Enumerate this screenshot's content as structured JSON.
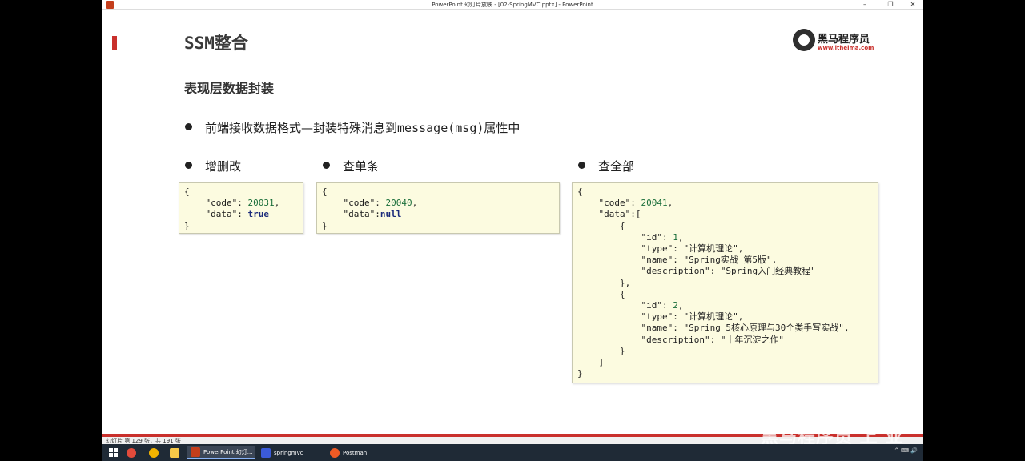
{
  "window": {
    "title": "PowerPoint 幻灯片放映 - [02-SpringMVC.pptx] - PowerPoint",
    "controls": [
      "–",
      "❐",
      "✕"
    ]
  },
  "slide": {
    "title": "SSM整合",
    "subtitle": "表现层数据封装",
    "logo": {
      "name": "黑马程序员",
      "url": "www.itheima.com"
    },
    "intro_bullet": "前端接收数据格式—封装特殊消息到",
    "intro_code": "message(msg)",
    "intro_tail": "属性中",
    "sections": [
      {
        "label": "增删改"
      },
      {
        "label": "查单条"
      },
      {
        "label": "查全部"
      }
    ],
    "code_crud": {
      "l1": "{",
      "code_key": "\"code\"",
      "code_val": "20031",
      "data_key": "\"data\"",
      "data_val": "true",
      "l4": "}"
    },
    "code_single": {
      "l1": "{",
      "code_key": "\"code\"",
      "code_val": "20040",
      "data_key": "\"data\"",
      "data_val": "null",
      "l4": "}"
    },
    "code_all": {
      "code_val": "20041",
      "item1": {
        "id": "1",
        "type": "\"计算机理论\"",
        "name": "\"Spring实战 第5版\"",
        "description": "\"Spring入门经典教程\""
      },
      "item2": {
        "id": "2",
        "type": "\"计算机理论\"",
        "name": "\"Spring 5核心原理与30个类手写实战\"",
        "description": "\"十年沉淀之作\""
      }
    }
  },
  "status": {
    "slide_counter": "幻灯片 第 129 张，共 191 张"
  },
  "watermark": "黑马程序员 上 业",
  "taskbar": {
    "items": [
      {
        "label": "PowerPoint 幻灯..."
      },
      {
        "label": "springmvc"
      },
      {
        "label": "Postman"
      }
    ],
    "tray_text": "^ ⌨ 🔊"
  },
  "colors": {
    "accent": "#c9302c",
    "code_bg": "#fcfbe0",
    "taskbar": "#1f2a36"
  }
}
